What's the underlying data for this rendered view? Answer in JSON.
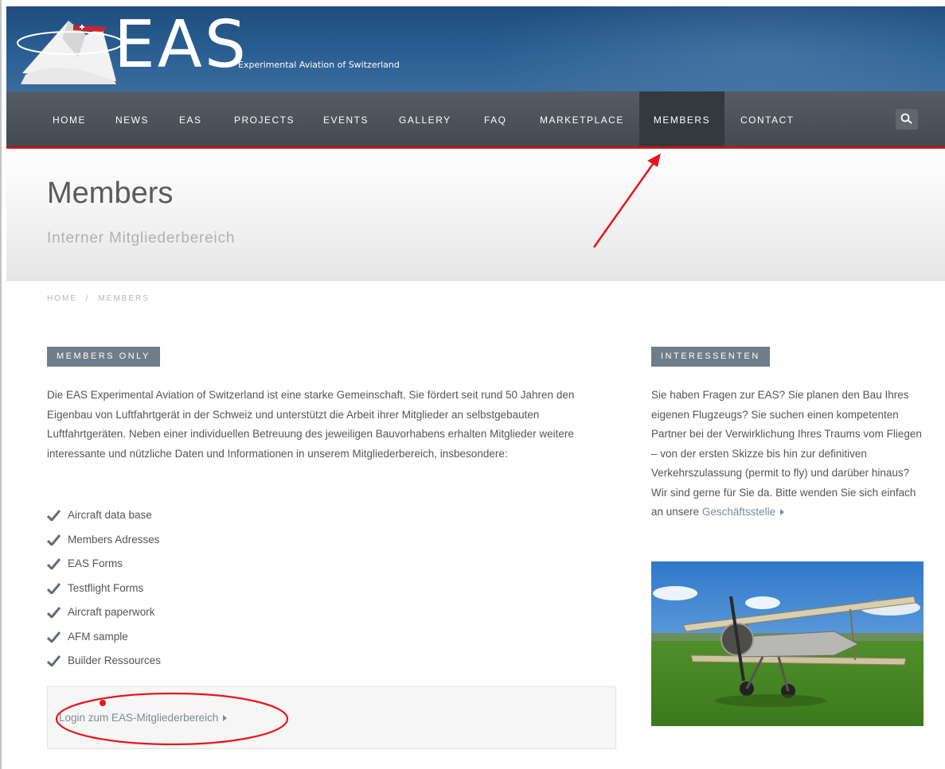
{
  "brand": {
    "logo_text": "EAS",
    "tagline": "Experimental Aviation of Switzerland"
  },
  "nav": {
    "items": [
      {
        "label": "HOME"
      },
      {
        "label": "NEWS"
      },
      {
        "label": "EAS"
      },
      {
        "label": "PROJECTS"
      },
      {
        "label": "EVENTS"
      },
      {
        "label": "GALLERY"
      },
      {
        "label": "FAQ"
      },
      {
        "label": "MARKETPLACE"
      },
      {
        "label": "MEMBERS",
        "active": true
      },
      {
        "label": "CONTACT"
      }
    ],
    "search_icon": "search-icon"
  },
  "page": {
    "title": "Members",
    "subtitle": "Interner Mitgliederbereich"
  },
  "breadcrumb": [
    "HOME",
    "/",
    "MEMBERS"
  ],
  "main": {
    "section_label": "MEMBERS ONLY",
    "intro": "Die EAS Experimental Aviation of Switzerland ist eine starke Gemeinschaft. Sie fördert seit rund 50 Jahren den Eigenbau von Luftfahrtgerät in der Schweiz und unterstützt die Arbeit ihrer Mitglieder an selbstgebauten Luftfahrtgeräten. Neben einer individuellen Betreuung des jeweiligen Bauvorhabens erhalten Mitglieder weitere interessante und nützliche Daten und Informationen in unserem Mitgliederbereich, insbesondere:",
    "features": [
      "Aircraft data base",
      "Members Adresses",
      "EAS Forms",
      "Testflight Forms",
      "Aircraft paperwork",
      "AFM sample",
      "Builder Ressources"
    ],
    "login_link": "Login zum EAS-Mitgliederbereich"
  },
  "sidebar": {
    "section_label": "INTERESSENTEN",
    "text": "Sie haben Fragen zur EAS? Sie planen den Bau Ihres eigenen Flugzeugs? Sie suchen einen kompetenten Partner bei der Verwirklichung Ihres Traums vom Fliegen – von der ersten Skizze bis hin zur definitiven Verkehrszulassung (permit to fly) und darüber hinaus? Wir sind gerne für Sie da. Bitte wenden Sie sich einfach an unsere",
    "link": "Geschäftsstelle"
  },
  "colors": {
    "accent_red": "#c0171c",
    "header_blue": "#2b5f93",
    "nav_gray": "#4a5158",
    "tag_gray": "#6f7d88",
    "annotation_red": "#e8161c"
  }
}
